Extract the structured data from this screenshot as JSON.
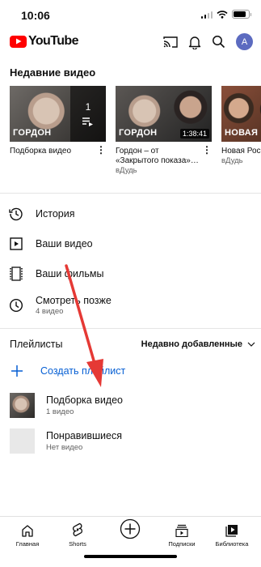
{
  "status_bar": {
    "time": "10:06",
    "battery_level": 0.85
  },
  "header": {
    "logo_text": "YouTube",
    "avatar_letter": "A",
    "icons": [
      "cast-icon",
      "bell-icon",
      "search-icon"
    ]
  },
  "recent": {
    "title": "Недавние видео",
    "items": [
      {
        "thumb_label": "ГОРДОН",
        "overlay_count": "1",
        "title": "Подборка видео",
        "channel": ""
      },
      {
        "thumb_label": "ГОРДОН",
        "duration": "1:38:41",
        "title": "Гордон – от «Закрытого показа»…",
        "channel": "вДудь"
      },
      {
        "thumb_label": "НОВАЯ Р",
        "title": "Новая Росс Hatters, Ак",
        "channel": "вДудь"
      }
    ]
  },
  "library": {
    "items": [
      {
        "label": "История",
        "icon": "history-icon"
      },
      {
        "label": "Ваши видео",
        "icon": "play-square-icon"
      },
      {
        "label": "Ваши фильмы",
        "icon": "film-icon"
      },
      {
        "label": "Смотреть позже",
        "sub": "4 видео",
        "icon": "clock-icon"
      }
    ]
  },
  "playlists": {
    "title": "Плейлисты",
    "sort_label": "Недавно добавленные",
    "create_label": "Создать плейлист",
    "items": [
      {
        "title": "Подборка видео",
        "sub": "1 видео"
      },
      {
        "title": "Понравившиеся",
        "sub": "Нет видео"
      }
    ]
  },
  "bottom_nav": {
    "items": [
      {
        "label": "Главная"
      },
      {
        "label": "Shorts"
      },
      {
        "label": ""
      },
      {
        "label": "Подписки"
      },
      {
        "label": "Библиотека"
      }
    ]
  },
  "colors": {
    "brand_red": "#ff0000",
    "link_blue": "#065fd4",
    "annotation_red": "#e53935"
  }
}
